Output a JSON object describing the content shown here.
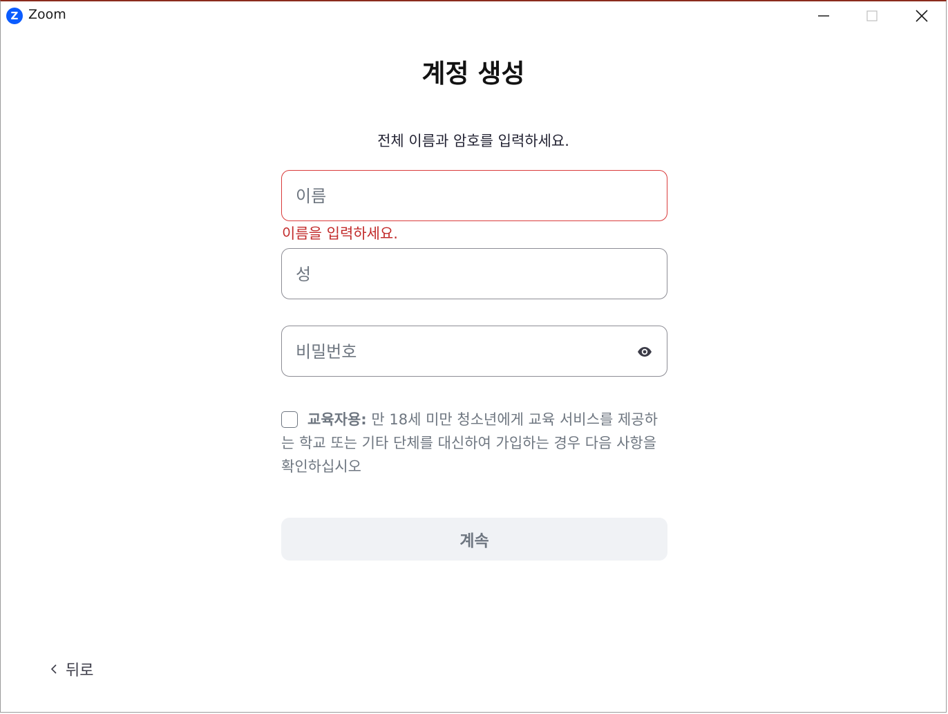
{
  "window": {
    "title": "Zoom",
    "logo_letter": "Z"
  },
  "page": {
    "heading": "계정 생성",
    "subtitle": "전체 이름과 암호를 입력하세요."
  },
  "form": {
    "first_name": {
      "placeholder": "이름",
      "value": "",
      "error": "이름을 입력하세요."
    },
    "last_name": {
      "placeholder": "성",
      "value": ""
    },
    "password": {
      "placeholder": "비밀번호",
      "value": ""
    },
    "education": {
      "checked": false,
      "label_bold": "교육자용:",
      "label_text": " 만 18세 미만 청소년에게 교육 서비스를 제공하는 학교 또는 기타 단체를 대신하여 가입하는 경우 다음 사항을 확인하십시오"
    },
    "continue_label": "계속"
  },
  "footer": {
    "back_label": "뒤로"
  },
  "icons": {
    "logo": "zoom-logo-icon",
    "minimize": "minimize-icon",
    "maximize": "maximize-icon",
    "close": "close-icon",
    "password_toggle": "eye-icon",
    "back": "chevron-left-icon"
  },
  "colors": {
    "brand": "#0b5cff",
    "error": "#d93a3a",
    "error_text": "#c22b2b",
    "button_bg": "#f0f2f5"
  }
}
